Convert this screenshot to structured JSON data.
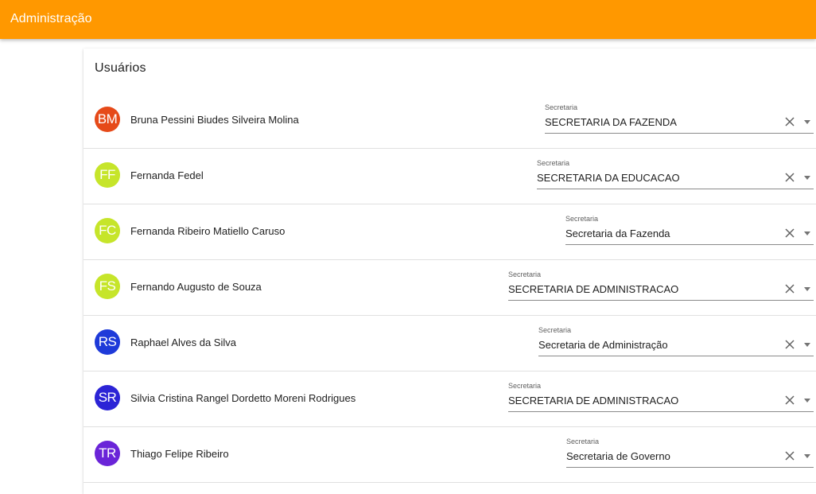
{
  "app_bar": {
    "title": "Administração",
    "color": "#ff9800"
  },
  "card": {
    "title": "Usuários"
  },
  "select_label": "Secretaria",
  "users": [
    {
      "initials": "BM",
      "name": "Bruna Pessini Biudes Silveira Molina",
      "secretaria": "SECRETARIA DA FAZENDA",
      "avatar_color": "#e64a19"
    },
    {
      "initials": "FF",
      "name": "Fernanda Fedel",
      "secretaria": "SECRETARIA DA EDUCACAO",
      "avatar_color": "#c6e52a"
    },
    {
      "initials": "FC",
      "name": "Fernanda Ribeiro Matiello Caruso",
      "secretaria": "Secretaria da Fazenda",
      "avatar_color": "#c6e52a"
    },
    {
      "initials": "FS",
      "name": "Fernando Augusto de Souza",
      "secretaria": "SECRETARIA DE ADMINISTRACAO",
      "avatar_color": "#c6e52a"
    },
    {
      "initials": "RS",
      "name": "Raphael Alves da Silva",
      "secretaria": "Secretaria de Administração",
      "avatar_color": "#1e3ad9"
    },
    {
      "initials": "SR",
      "name": "Silvia Cristina Rangel Dordetto Moreni Rodrigues",
      "secretaria": "SECRETARIA DE ADMINISTRACAO",
      "avatar_color": "#2c24d6"
    },
    {
      "initials": "TR",
      "name": "Thiago Felipe Ribeiro",
      "secretaria": "Secretaria de Governo",
      "avatar_color": "#6a24d8"
    }
  ]
}
